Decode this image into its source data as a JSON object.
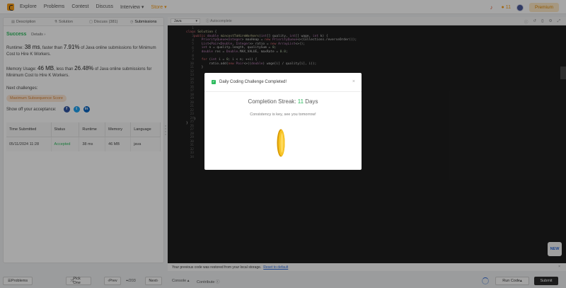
{
  "nav": {
    "links": [
      "Explore",
      "Problems",
      "Contest",
      "Discuss",
      "Interview ▾",
      "Store ▾"
    ],
    "streak_count": "11",
    "premium_label": "Premium"
  },
  "left": {
    "tabs": [
      "Description",
      "Solution",
      "Discuss (381)",
      "Submissions"
    ],
    "status": "Success",
    "details_label": "Details",
    "runtime_text_1": "Runtime: ",
    "runtime_value": "38 ms",
    "runtime_text_2": ", faster than ",
    "runtime_pct": "7.91%",
    "runtime_text_3": " of Java online submissions for Minimum Cost to Hire K Workers.",
    "memory_text_1": "Memory Usage: ",
    "memory_value": "46 MB",
    "memory_text_2": ", less than ",
    "memory_pct": "26.48%",
    "memory_text_3": " of Java online submissions for Minimum Cost to Hire K Workers.",
    "next_label": "Next challenges:",
    "next_pill": "Maximum Subsequence Score",
    "share_label": "Show off your acceptance:",
    "table": {
      "headers": [
        "Time Submitted",
        "Status",
        "Runtime",
        "Memory",
        "Language"
      ],
      "rows": [
        [
          "05/11/2024 11:28",
          "Accepted",
          "38 ms",
          "46 MB",
          "java"
        ]
      ]
    }
  },
  "editor": {
    "language": "Java",
    "autocomplete": "Autocomplete",
    "new_label": "NEW"
  },
  "restore": {
    "text": "Your previous code was restored from your local storage.",
    "link": "Reset to default"
  },
  "bottom": {
    "problems": "Problems",
    "pick_one": "Pick One",
    "prev": "Prev",
    "page": "/203",
    "next": "Next",
    "console": "Console",
    "contribute": "Contribute",
    "run_code": "Run Code",
    "submit": "Submit"
  },
  "modal": {
    "title": "Daily Coding Challenge Completed!",
    "streak_label": "Completion Streak: ",
    "streak_value": "11",
    "streak_unit": " Days",
    "subtitle": "Consistency is key, see you tomorrow!"
  },
  "colors": {
    "accent_green": "#2cbb5d",
    "brand_orange": "#f89f1b",
    "link_blue": "#2f6bd9"
  }
}
